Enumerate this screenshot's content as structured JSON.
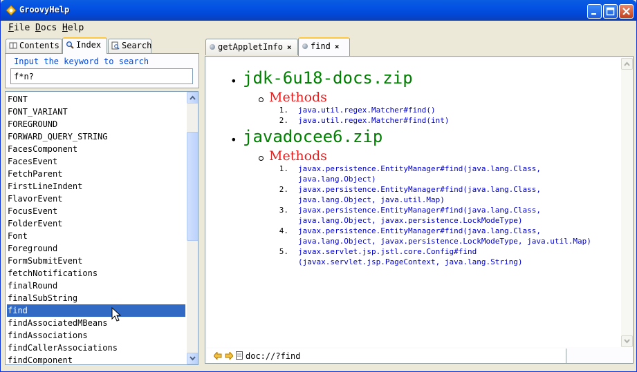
{
  "window": {
    "title": "GroovyHelp"
  },
  "menu": {
    "file": "File",
    "file_rest": "ile",
    "file_key": "F",
    "docs_key": "D",
    "docs_rest": "ocs",
    "help_key": "H",
    "help_rest": "elp"
  },
  "left_tabs": [
    {
      "label": "Contents"
    },
    {
      "label": "Index"
    },
    {
      "label": "Search"
    }
  ],
  "search": {
    "legend": "Input the keyword to search",
    "value": "f*n?"
  },
  "index_items": [
    "FONT",
    "FONT_VARIANT",
    "FOREGROUND",
    "FORWARD_QUERY_STRING",
    "FacesComponent",
    "FacesEvent",
    "FetchParent",
    "FirstLineIndent",
    "FlavorEvent",
    "FocusEvent",
    "FolderEvent",
    "Font",
    "Foreground",
    "FormSubmitEvent",
    "fetchNotifications",
    "finalRound",
    "finalSubString",
    "find",
    "findAssociatedMBeans",
    "findAssociations",
    "findCallerAssociations",
    "findComponent"
  ],
  "selected_index": 17,
  "right_tabs": [
    {
      "label": "getAppletInfo",
      "close": "×"
    },
    {
      "label": "find",
      "close": "×"
    }
  ],
  "doc": {
    "sections": [
      {
        "title": "jdk-6u18-docs.zip",
        "heading": "Methods",
        "items": [
          {
            "num": "1.",
            "lines": [
              "java.util.regex.Matcher#find()"
            ]
          },
          {
            "num": "2.",
            "lines": [
              "java.util.regex.Matcher#find(int)"
            ]
          }
        ]
      },
      {
        "title": "javadocee6.zip",
        "heading": "Methods",
        "items": [
          {
            "num": "1.",
            "lines": [
              "javax.persistence.EntityManager#find(java.lang.Class,",
              "java.lang.Object)"
            ]
          },
          {
            "num": "2.",
            "lines": [
              "javax.persistence.EntityManager#find(java.lang.Class,",
              "java.lang.Object, java.util.Map)"
            ]
          },
          {
            "num": "3.",
            "lines": [
              "javax.persistence.EntityManager#find(java.lang.Class,",
              "java.lang.Object, javax.persistence.LockModeType)"
            ]
          },
          {
            "num": "4.",
            "lines": [
              "javax.persistence.EntityManager#find(java.lang.Class,",
              "java.lang.Object, javax.persistence.LockModeType, java.util.Map)"
            ]
          },
          {
            "num": "5.",
            "lines": [
              "javax.servlet.jsp.jstl.core.Config#find",
              "(javax.servlet.jsp.PageContext, java.lang.String)"
            ]
          }
        ]
      }
    ]
  },
  "status": {
    "url": "doc://?find"
  },
  "colors": {
    "title_green": "#008000",
    "methods_red": "#e02020",
    "link_blue": "#0000cc",
    "selection": "#316ac5"
  }
}
